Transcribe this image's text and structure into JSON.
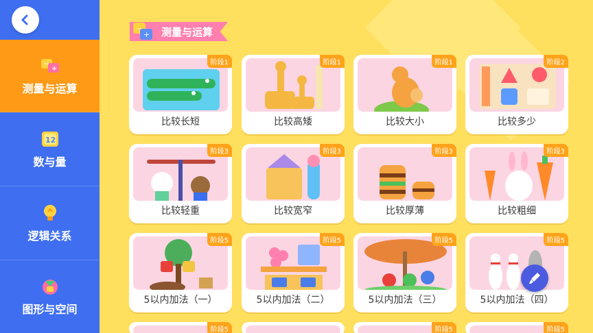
{
  "sidebar": {
    "items": [
      {
        "label": "测量与运算",
        "icon": "measure-calc-icon",
        "active": true
      },
      {
        "label": "数与量",
        "icon": "number-blocks-icon",
        "active": false
      },
      {
        "label": "逻辑关系",
        "icon": "lightbulb-icon",
        "active": false
      },
      {
        "label": "图形与空间",
        "icon": "shapes-icon",
        "active": false
      }
    ]
  },
  "section": {
    "title": "测量与运算"
  },
  "cards": [
    {
      "title": "比较长短",
      "stage": "阶段1",
      "art": "crocodiles"
    },
    {
      "title": "比较高矮",
      "stage": "阶段1",
      "art": "giraffes"
    },
    {
      "title": "比较大小",
      "stage": "阶段1",
      "art": "kangaroo"
    },
    {
      "title": "比较多少",
      "stage": "阶段2",
      "art": "shapes-grid"
    },
    {
      "title": "比较轻重",
      "stage": "阶段3",
      "art": "balance"
    },
    {
      "title": "比较宽窄",
      "stage": "阶段3",
      "art": "houses"
    },
    {
      "title": "比较厚薄",
      "stage": "阶段3",
      "art": "burgers"
    },
    {
      "title": "比较粗细",
      "stage": "阶段3",
      "art": "carrots"
    },
    {
      "title": "5以内加法（一）",
      "stage": "阶段5",
      "art": "tree-boxes"
    },
    {
      "title": "5以内加法（二）",
      "stage": "阶段5",
      "art": "pigs-sum"
    },
    {
      "title": "5以内加法（三）",
      "stage": "阶段5",
      "art": "bugs"
    },
    {
      "title": "5以内加法（四）",
      "stage": "阶段5",
      "art": "bowling"
    },
    {
      "title": "",
      "stage": "阶段5",
      "art": "peek"
    },
    {
      "title": "",
      "stage": "",
      "art": "peek"
    },
    {
      "title": "",
      "stage": "阶段5",
      "art": "peek"
    },
    {
      "title": "",
      "stage": "阶段5",
      "art": "peek"
    }
  ],
  "colors": {
    "sidebar": "#3f6ff0",
    "active": "#ff9a16",
    "background": "#ffdf5e",
    "badge": "#ffa31a",
    "ribbon": "#ff7fae"
  }
}
